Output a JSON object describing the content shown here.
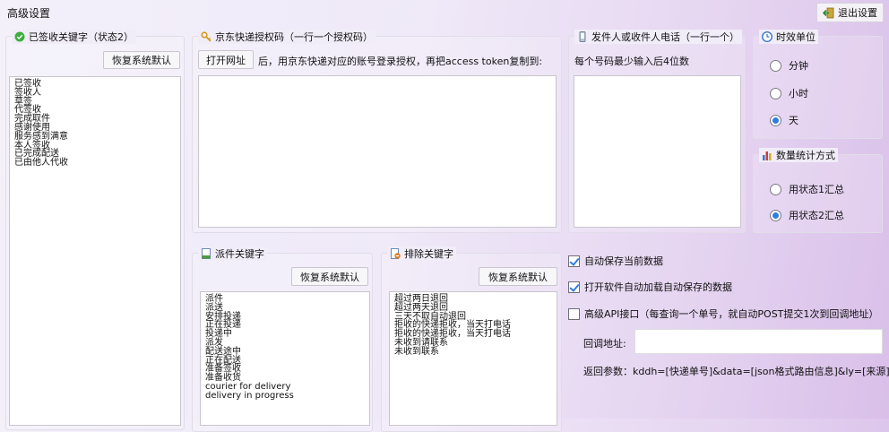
{
  "window": {
    "title": "高级设置",
    "exit_label": "退出设置"
  },
  "signed_keywords": {
    "legend": "已签收关键字（状态2）",
    "restore_label": "恢复系统默认",
    "items": [
      "已签收",
      "签收人",
      "草签",
      "代签收",
      "完成取件",
      "感谢使用",
      "服务感到满意",
      "本人签收",
      "已完成配送",
      "已由他人代收"
    ]
  },
  "jd_auth": {
    "legend": "京东快递授权码（一行一个授权码）",
    "open_url_label": "打开网址",
    "hint": "后，用京东快递对应的账号登录授权，再把access token复制到:",
    "value": ""
  },
  "phone": {
    "legend": "发件人或收件人电话（一行一个）",
    "hint": "每个号码最少输入后4位数",
    "value": ""
  },
  "time_unit": {
    "legend": "时效单位",
    "options": [
      "分钟",
      "小时",
      "天"
    ],
    "selected": "天"
  },
  "count_method": {
    "legend": "数量统计方式",
    "options": [
      "用状态1汇总",
      "用状态2汇总"
    ],
    "selected": "用状态2汇总"
  },
  "dispatch_keywords": {
    "legend": "派件关键字",
    "restore_label": "恢复系统默认",
    "items": [
      "派件",
      "派送",
      "安排投递",
      "正在投递",
      "投递中",
      "派发",
      "配送途中",
      "正在配送",
      "准备签收",
      "准备收货",
      "courier for delivery",
      "delivery in progress"
    ]
  },
  "exclude_keywords": {
    "legend": "排除关键字",
    "restore_label": "恢复系统默认",
    "items": [
      "超过两日退回",
      "超过两天退回",
      "三天不取自动退回",
      "拒收的快递拒收，当天打电话",
      "拒收的快递拒收，当天打电话",
      "未收到请联系",
      "未收到联系"
    ]
  },
  "options": {
    "auto_save_label": "自动保存当前数据",
    "auto_save_checked": true,
    "auto_load_label": "打开软件自动加载自动保存的数据",
    "auto_load_checked": true,
    "api_label": "高级API接口（每查询一个单号，就自动POST提交1次到回调地址）",
    "api_checked": false,
    "callback_label": "回调地址:",
    "callback_value": "",
    "return_params": "返回参数：kddh=[快递单号]&data=[json格式路由信息]&ly=[来源]"
  }
}
